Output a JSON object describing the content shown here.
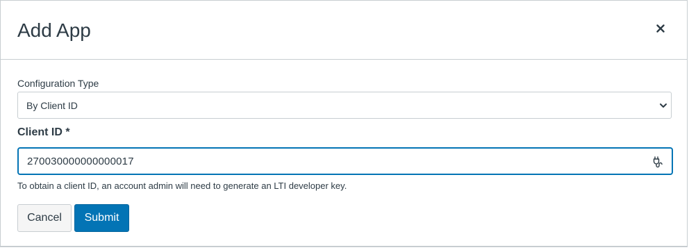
{
  "dialog": {
    "title": "Add App",
    "close_icon": "close-icon"
  },
  "config": {
    "label": "Configuration Type",
    "selected": "By Client ID"
  },
  "client_id": {
    "label": "Client ID *",
    "value": "270030000000000017",
    "icon": "plug-icon",
    "help": "To obtain a client ID, an account admin will need to generate an LTI developer key."
  },
  "actions": {
    "cancel_label": "Cancel",
    "submit_label": "Submit"
  },
  "colors": {
    "primary": "#0374b5",
    "text": "#2d3b45",
    "border": "#c7cdd1"
  }
}
